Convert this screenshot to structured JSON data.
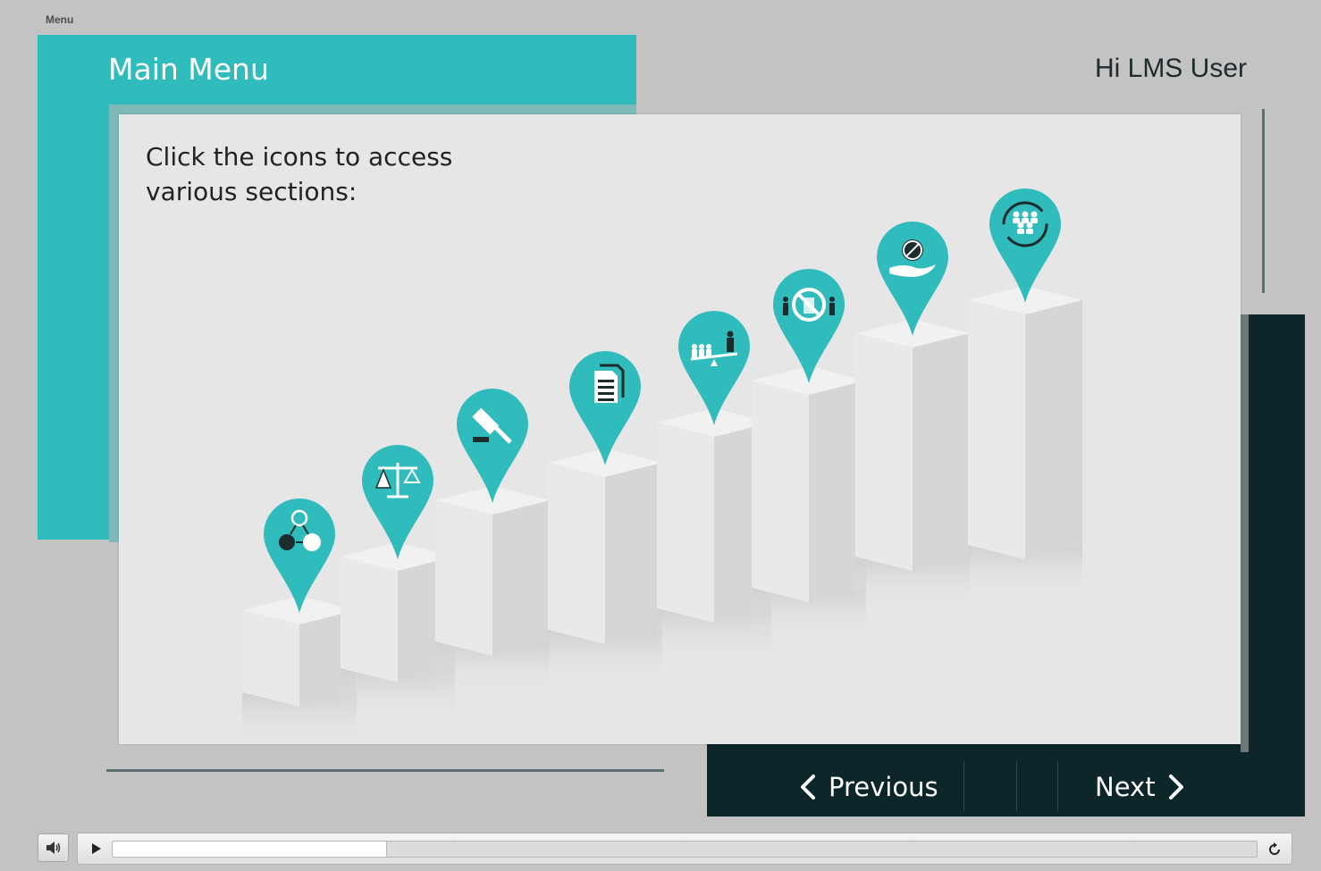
{
  "menu_label": "Menu",
  "header": {
    "title": "Main Menu",
    "greeting": "Hi LMS User"
  },
  "content": {
    "instructions": "Click the icons to access various sections:"
  },
  "colors": {
    "teal": "#30bbbd",
    "dark": "#0d2629",
    "card": "#e6e6e6"
  },
  "sections": [
    {
      "icon": "network-icon"
    },
    {
      "icon": "scales-icon"
    },
    {
      "icon": "gavel-icon"
    },
    {
      "icon": "document-icon"
    },
    {
      "icon": "seesaw-people-icon"
    },
    {
      "icon": "no-discrimination-icon"
    },
    {
      "icon": "hand-prohibition-icon"
    },
    {
      "icon": "team-cycle-icon"
    }
  ],
  "nav": {
    "previous_label": "Previous",
    "next_label": "Next"
  },
  "player": {
    "progress": 0.24
  }
}
